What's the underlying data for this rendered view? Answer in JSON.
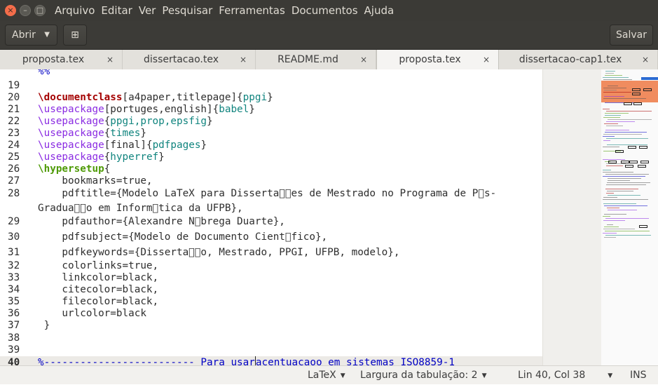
{
  "menubar": {
    "window_buttons": {
      "close": "×",
      "minimize": "–",
      "maximize": "□"
    },
    "menus": [
      "Arquivo",
      "Editar",
      "Ver",
      "Pesquisar",
      "Ferramentas",
      "Documentos",
      "Ajuda"
    ]
  },
  "toolbar": {
    "open_label": "Abrir",
    "open_arrow": "▼",
    "new_tab_icon": "new-document-icon",
    "new_tab_glyph": "⊞",
    "save_label": "Salvar"
  },
  "tabs": [
    {
      "label": "proposta.tex",
      "close": "×",
      "active": false
    },
    {
      "label": "dissertacao.tex",
      "close": "×",
      "active": false
    },
    {
      "label": "README.md",
      "close": "×",
      "active": false
    },
    {
      "label": "proposta.tex",
      "close": "×",
      "active": true
    },
    {
      "label": "dissertacao-cap1.tex",
      "close": "×",
      "active": false
    }
  ],
  "editor": {
    "lines": [
      {
        "n": "",
        "segs": [
          {
            "t": "%%",
            "c": "com"
          }
        ]
      },
      {
        "n": "19",
        "segs": []
      },
      {
        "n": "20",
        "segs": [
          {
            "t": "\\documentclass",
            "c": "kw"
          },
          {
            "t": "[a4paper,titlepage]{",
            "c": ""
          },
          {
            "t": "ppgi",
            "c": "arg"
          },
          {
            "t": "}",
            "c": ""
          }
        ]
      },
      {
        "n": "21",
        "segs": [
          {
            "t": "\\usepackage",
            "c": "cmd"
          },
          {
            "t": "[portuges,english]{",
            "c": ""
          },
          {
            "t": "babel",
            "c": "arg"
          },
          {
            "t": "}",
            "c": ""
          }
        ]
      },
      {
        "n": "22",
        "segs": [
          {
            "t": "\\usepackage",
            "c": "cmd"
          },
          {
            "t": "{",
            "c": ""
          },
          {
            "t": "ppgi,prop,epsfig",
            "c": "arg"
          },
          {
            "t": "}",
            "c": ""
          }
        ]
      },
      {
        "n": "23",
        "segs": [
          {
            "t": "\\usepackage",
            "c": "cmd"
          },
          {
            "t": "{",
            "c": ""
          },
          {
            "t": "times",
            "c": "arg"
          },
          {
            "t": "}",
            "c": ""
          }
        ]
      },
      {
        "n": "24",
        "segs": [
          {
            "t": "\\usepackage",
            "c": "cmd"
          },
          {
            "t": "[final]{",
            "c": ""
          },
          {
            "t": "pdfpages",
            "c": "arg"
          },
          {
            "t": "}",
            "c": ""
          }
        ]
      },
      {
        "n": "25",
        "segs": [
          {
            "t": "\\usepackage",
            "c": "cmd"
          },
          {
            "t": "{",
            "c": ""
          },
          {
            "t": "hyperref",
            "c": "arg"
          },
          {
            "t": "}",
            "c": ""
          }
        ]
      },
      {
        "n": "26",
        "segs": [
          {
            "t": "\\hypersetup",
            "c": "cmd g"
          },
          {
            "t": "{",
            "c": ""
          }
        ]
      },
      {
        "n": "27",
        "segs": [
          {
            "t": "    bookmarks=true,",
            "c": ""
          }
        ]
      },
      {
        "n": "28",
        "segs": [
          {
            "t": "    pdftitle={Modelo LaTeX para Disserta\u0000\u0000es de Mestrado no Programa de P\u0000s-",
            "c": ""
          }
        ]
      },
      {
        "n": "",
        "segs": [
          {
            "t": "Gradua\u0000\u0000o em Inform\u0000tica da UFPB},",
            "c": ""
          }
        ]
      },
      {
        "n": "29",
        "segs": [
          {
            "t": "    pdfauthor={Alexandre N\u0000brega Duarte},",
            "c": ""
          }
        ]
      },
      {
        "n": "30",
        "segs": [
          {
            "t": "    pdfsubject={Modelo de Documento Cient\u0000fico},",
            "c": ""
          }
        ]
      },
      {
        "n": "31",
        "segs": [
          {
            "t": "    pdfkeywords={Disserta\u0000\u0000o, Mestrado, PPGI, UFPB, modelo},",
            "c": ""
          }
        ]
      },
      {
        "n": "32",
        "segs": [
          {
            "t": "    colorlinks=true,",
            "c": ""
          }
        ]
      },
      {
        "n": "33",
        "segs": [
          {
            "t": "    linkcolor=black,",
            "c": ""
          }
        ]
      },
      {
        "n": "34",
        "segs": [
          {
            "t": "    citecolor=black,",
            "c": ""
          }
        ]
      },
      {
        "n": "35",
        "segs": [
          {
            "t": "    filecolor=black,",
            "c": ""
          }
        ]
      },
      {
        "n": "36",
        "segs": [
          {
            "t": "    urlcolor=black",
            "c": ""
          }
        ]
      },
      {
        "n": "37",
        "segs": [
          {
            "t": " }",
            "c": ""
          }
        ]
      },
      {
        "n": "38",
        "segs": []
      },
      {
        "n": "39",
        "segs": []
      },
      {
        "n": "40",
        "current": true,
        "segs": [
          {
            "t": "%------------------------- Para usar",
            "c": "com"
          },
          {
            "t": "|",
            "c": "cursor"
          },
          {
            "t": "acentuacaoo em sistemas ISO8859-1",
            "c": "com"
          }
        ]
      }
    ]
  },
  "statusbar": {
    "language": "LaTeX",
    "tab_width": "Largura da tabulação: 2",
    "position": "Lin 40, Col 38",
    "mode": "INS",
    "dropdown_glyph": "▼"
  },
  "colors": {
    "menubar_bg": "#3b3a36",
    "close_button": "#f46d4a",
    "keyword": "#a40000",
    "command": "#8a2be2",
    "argument": "#10847e",
    "comment": "#0000c4",
    "minimap_highlight": "#f08c5f"
  }
}
